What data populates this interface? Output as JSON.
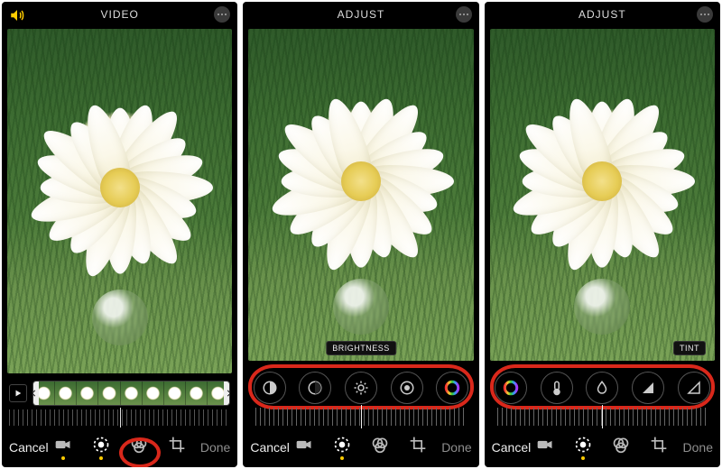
{
  "screens": [
    {
      "title": "VIDEO",
      "speaker": true,
      "scrubber": {
        "frames": 9
      },
      "bottom": {
        "cancel": "Cancel",
        "done": "Done",
        "modes": [
          {
            "name": "video-mode-icon",
            "active": false,
            "selectedDot": true
          },
          {
            "name": "adjust-mode-icon",
            "active": true,
            "selectedDot": false,
            "annotated": true
          },
          {
            "name": "filters-mode-icon",
            "active": false,
            "selectedDot": false
          },
          {
            "name": "crop-mode-icon",
            "active": false,
            "selectedDot": false
          }
        ]
      }
    },
    {
      "title": "ADJUST",
      "chip": {
        "label": "BRIGHTNESS",
        "side": "center"
      },
      "tools": [
        {
          "name": "exposure-tool-icon"
        },
        {
          "name": "highlights-tool-icon"
        },
        {
          "name": "brightness-tool-icon"
        },
        {
          "name": "blackpoint-tool-icon"
        },
        {
          "name": "saturation-tool-icon"
        }
      ],
      "bottom": {
        "cancel": "Cancel",
        "done": "Done",
        "modes": [
          {
            "name": "video-mode-icon",
            "active": false,
            "selectedDot": false
          },
          {
            "name": "adjust-mode-icon",
            "active": true,
            "selectedDot": true
          },
          {
            "name": "filters-mode-icon",
            "active": false,
            "selectedDot": false
          },
          {
            "name": "crop-mode-icon",
            "active": false,
            "selectedDot": false
          }
        ]
      }
    },
    {
      "title": "ADJUST",
      "chip": {
        "label": "TINT",
        "side": "right"
      },
      "tools": [
        {
          "name": "saturation-tool-icon"
        },
        {
          "name": "warmth-tool-icon"
        },
        {
          "name": "tint-tool-icon"
        },
        {
          "name": "sharpness-tool-icon"
        },
        {
          "name": "definition-tool-icon"
        }
      ],
      "bottom": {
        "cancel": "Cancel",
        "done": "Done",
        "modes": [
          {
            "name": "video-mode-icon",
            "active": false,
            "selectedDot": false
          },
          {
            "name": "adjust-mode-icon",
            "active": true,
            "selectedDot": true
          },
          {
            "name": "filters-mode-icon",
            "active": false,
            "selectedDot": false
          },
          {
            "name": "crop-mode-icon",
            "active": false,
            "selectedDot": false
          }
        ]
      }
    }
  ],
  "colors": {
    "accent": "#ffcc00",
    "annotation": "#d9281b"
  }
}
